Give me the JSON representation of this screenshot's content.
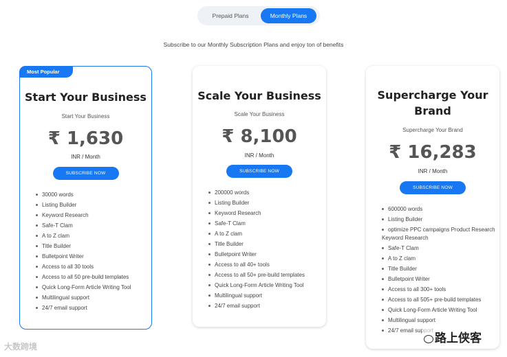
{
  "toggle": {
    "prepaid_label": "Prepaid Plans",
    "monthly_label": "Monthly Plans",
    "selected": "Monthly Plans"
  },
  "intro": "Subscribe to our Monthly Subscription Plans and enjoy ton of benefits",
  "plans": [
    {
      "badge": "Most Popular",
      "title": "Start Your Business",
      "subtitle": "Start Your Business",
      "price": "₹ 1,630",
      "period": "INR / Month",
      "button": "SUBSCRIBE NOW",
      "features": [
        "30000 words",
        "Listing Builder",
        "Keyword Research",
        "Safe-T Clam",
        "A to Z clam",
        "Title Builder",
        "Bulletpoint Writer",
        "Access to all 30 tools",
        "Access to all 50 pre-build templates",
        "Quick Long-Form Article Writing Tool",
        "Multilingual support",
        "24/7 email support"
      ]
    },
    {
      "title": "Scale Your Business",
      "subtitle": "Scale Your Business",
      "price": "₹ 8,100",
      "period": "INR / Month",
      "button": "SUBSCRIBE NOW",
      "features": [
        "200000 words",
        "Listing Builder",
        "Keyword Research",
        "Safe-T Clam",
        "A to Z clam",
        "Title Builder",
        "Bulletpoint Writer",
        "Access to all 40+ tools",
        "Access to all 50+ pre-build templates",
        "Quick Long-Form Article Writing Tool",
        "Multilingual support",
        "24/7 email support"
      ]
    },
    {
      "title": "Supercharge Your Brand",
      "subtitle": "Supercharge Your Brand",
      "price": "₹ 16,283",
      "period": "INR / Month",
      "button": "SUBSCRIBE NOW",
      "features": [
        "600000 words",
        "Listing Builder",
        "optimize PPC campaigns Product Research Keyword Research",
        "Safe-T Clam",
        "A to Z clam",
        "Title Builder",
        "Bulletpoint Writer",
        "Access to all 300+ tools",
        "Access to all 505+ pre-build templates",
        "Quick Long-Form Article Writing Tool",
        "Multilingual support",
        "24/7 email support"
      ]
    }
  ],
  "watermarks": {
    "left": "大数跨境",
    "right": "路上侠客"
  },
  "colors": {
    "accent": "#1877f2",
    "price": "#555555"
  }
}
